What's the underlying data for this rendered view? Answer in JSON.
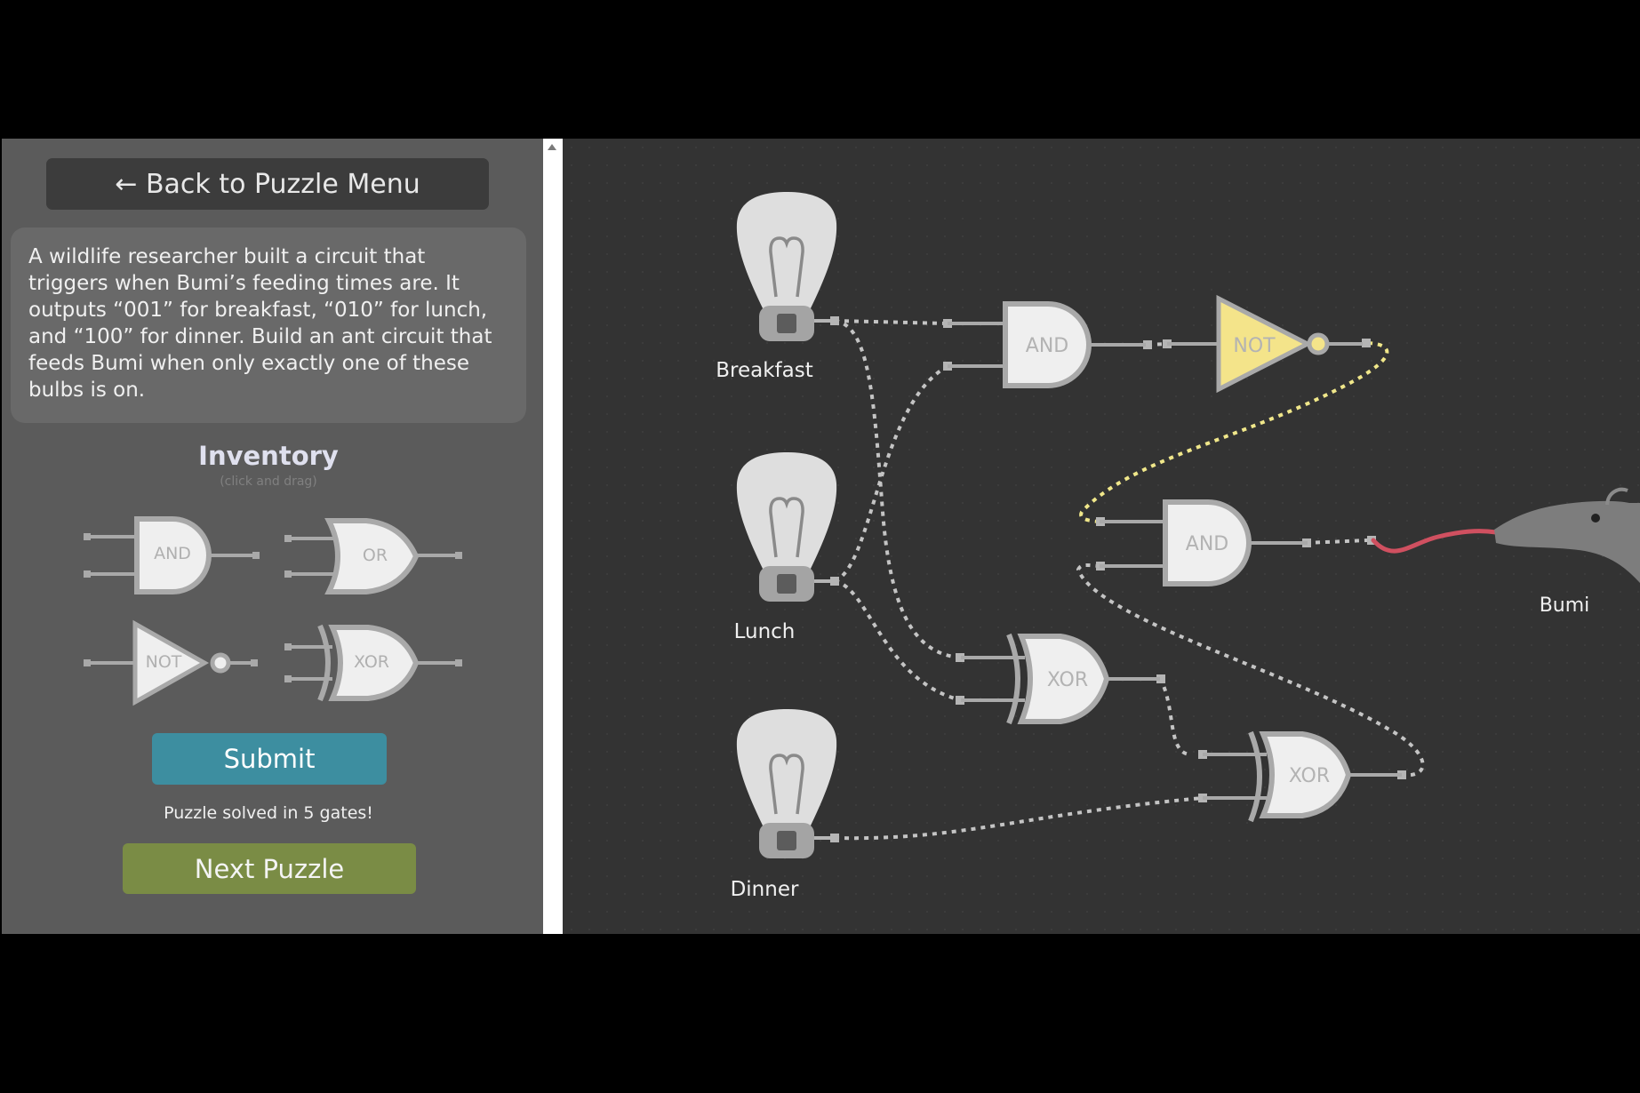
{
  "sidebar": {
    "back_button": "← Back to Puzzle Menu",
    "description": "A wildlife researcher built a circuit that triggers when Bumi’s feeding times are. It outputs “001” for breakfast, “010” for lunch, and “100” for dinner. Build an ant circuit that feeds Bumi when only exactly one of these bulbs is on.",
    "inventory_title": "Inventory",
    "inventory_hint": "(click and drag)",
    "inventory": [
      "AND",
      "OR",
      "NOT",
      "XOR"
    ],
    "submit": "Submit",
    "status": "Puzzle solved in 5 gates!",
    "next": "Next Puzzle"
  },
  "circuit": {
    "bulbs": [
      "Breakfast",
      "Lunch",
      "Dinner"
    ],
    "gates": {
      "and_top": "AND",
      "not_top": "NOT",
      "and_mid": "AND",
      "xor_mid": "XOR",
      "xor_bottom": "XOR"
    },
    "target": "Bumi"
  },
  "colors": {
    "sidebar_bg": "#5b5b5b",
    "canvas_bg": "#333333",
    "gate_fill": "#efefef",
    "gate_stroke": "#a9a9a9",
    "active_gate": "#f4e48a",
    "active_wire": "#f0e78a",
    "submit": "#3d8ea0",
    "next": "#7a8c45",
    "tongue": "#d05060"
  }
}
